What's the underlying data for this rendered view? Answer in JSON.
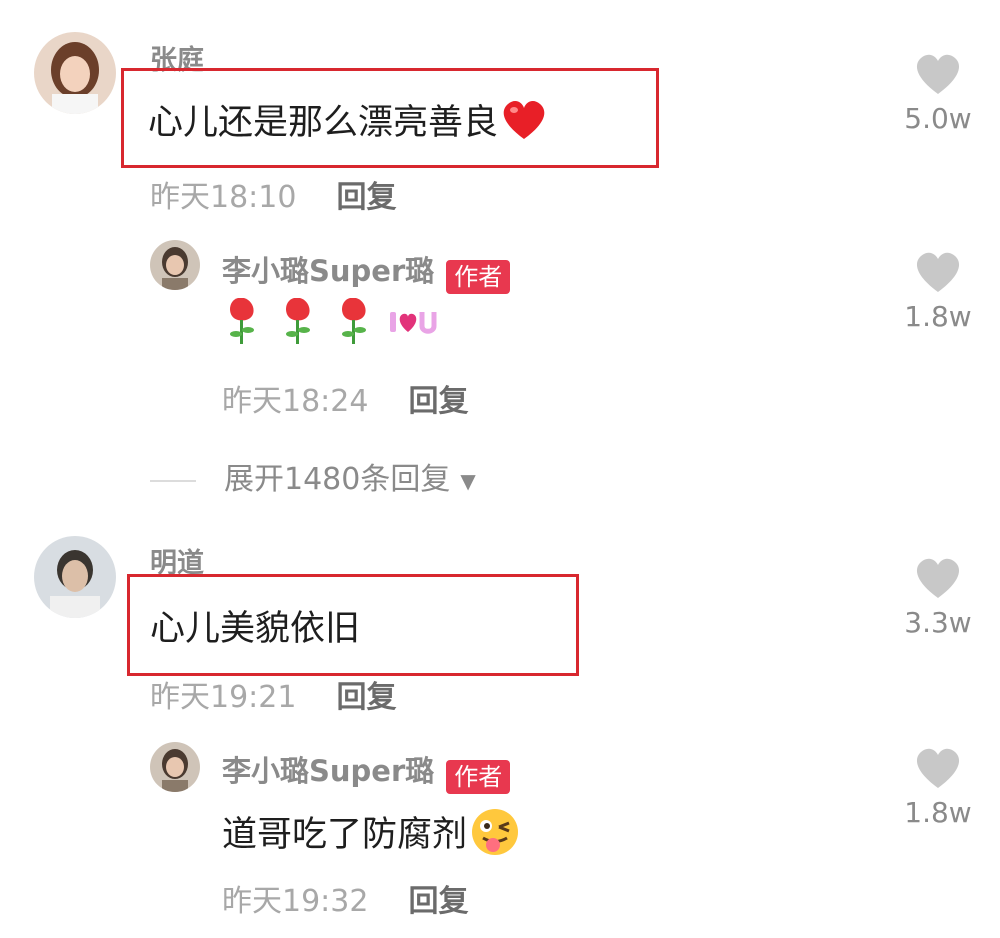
{
  "comments": [
    {
      "username": "张庭",
      "text": "心儿还是那么漂亮善良",
      "time": "昨天18:10",
      "reply_label": "回复",
      "likes": "5.0w",
      "reply": {
        "username": "李小璐Super璐",
        "badge": "作者",
        "text": "",
        "time": "昨天18:24",
        "reply_label": "回复",
        "likes": "1.8w"
      },
      "expand": "展开1480条回复"
    },
    {
      "username": "明道",
      "text": "心儿美貌依旧",
      "time": "昨天19:21",
      "reply_label": "回复",
      "likes": "3.3w",
      "reply": {
        "username": "李小璐Super璐",
        "badge": "作者",
        "text": "道哥吃了防腐剂",
        "time": "昨天19:32",
        "reply_label": "回复",
        "likes": "1.8w"
      }
    }
  ],
  "colors": {
    "highlight_box": "#d8282f",
    "author_badge": "#e8384f",
    "like_icon": "#c8c8c8"
  }
}
